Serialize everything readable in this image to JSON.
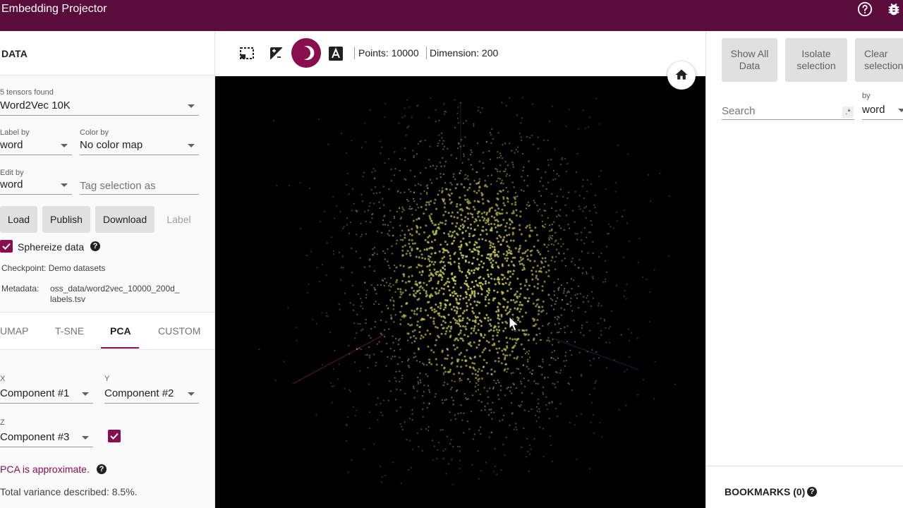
{
  "app": {
    "title": "Embedding Projector"
  },
  "left_panel": {
    "title": "DATA",
    "tensors_found": "5 tensors found",
    "tensor_selected": "Word2Vec 10K",
    "label_by_label": "Label by",
    "label_by_value": "word",
    "color_by_label": "Color by",
    "color_by_value": "No color map",
    "edit_by_label": "Edit by",
    "edit_by_value": "word",
    "tag_placeholder": "Tag selection as",
    "buttons": {
      "load": "Load",
      "publish": "Publish",
      "download": "Download",
      "label": "Label"
    },
    "sphereize_label": "Sphereize data",
    "sphereize_checked": true,
    "checkpoint_text": "Checkpoint: Demo datasets",
    "metadata_label": "Metadata:",
    "metadata_value_line1": "oss_data/word2vec_10000_200d_",
    "metadata_value_line2": "labels.tsv"
  },
  "projection_tabs": [
    {
      "label": "UMAP"
    },
    {
      "label": "T-SNE"
    },
    {
      "label": "PCA",
      "active": true
    },
    {
      "label": "CUSTOM"
    }
  ],
  "pca": {
    "x_label": "X",
    "x_value": "Component #1",
    "y_label": "Y",
    "y_value": "Component #2",
    "z_label": "Z",
    "z_value": "Component #3",
    "z_enabled": true,
    "approx_text": "PCA is approximate.",
    "variance_text": "Total variance described: 8.5%."
  },
  "toolbar": {
    "points_text": "Points: 10000",
    "dimension_text": "Dimension: 200"
  },
  "right_panel": {
    "show_all_line1": "Show All",
    "show_all_line2": "Data",
    "isolate_line1": "Isolate",
    "isolate_line2": "selection",
    "clear_line1": "Clear",
    "clear_line2": "selection",
    "search_placeholder": "Search",
    "regex_label": ".*",
    "by_label": "by",
    "by_value": "word",
    "bookmarks_title": "BOOKMARKS (0)"
  },
  "colors": {
    "topbar": "#5a0d3a",
    "accent": "#880e4f",
    "point_color": "#c6c65a",
    "canvas_bg": "#000000"
  }
}
